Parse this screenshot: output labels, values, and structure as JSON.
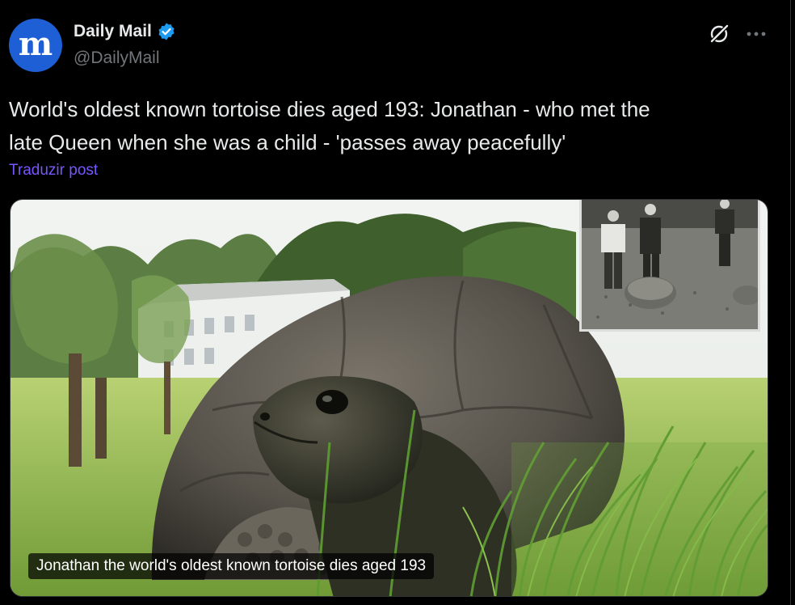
{
  "author": {
    "display_name": "Daily Mail",
    "handle": "@DailyMail",
    "avatar_letter": "m",
    "avatar_color": "#1f5fd6",
    "verified_icon": "verified-badge-icon",
    "verified_color": "#1d9bf0"
  },
  "header_actions": {
    "grok_icon": "grok-icon",
    "more_icon": "more-options-icon"
  },
  "post": {
    "text": "World's oldest known tortoise dies aged 193: Jonathan - who met the\nlate Queen when she was a child - 'passes away peacefully'",
    "translate_label": "Traduzir post",
    "translate_color": "#7856ff"
  },
  "media": {
    "caption": "Jonathan the world's oldest known tortoise dies aged 193",
    "main_image": "giant-tortoise-in-grass-photo",
    "inset_image": "historical-black-and-white-photo"
  },
  "theme": {
    "background": "#000000",
    "text_primary": "#e7e9ea",
    "text_secondary": "#71767b",
    "border": "#2f3336"
  }
}
